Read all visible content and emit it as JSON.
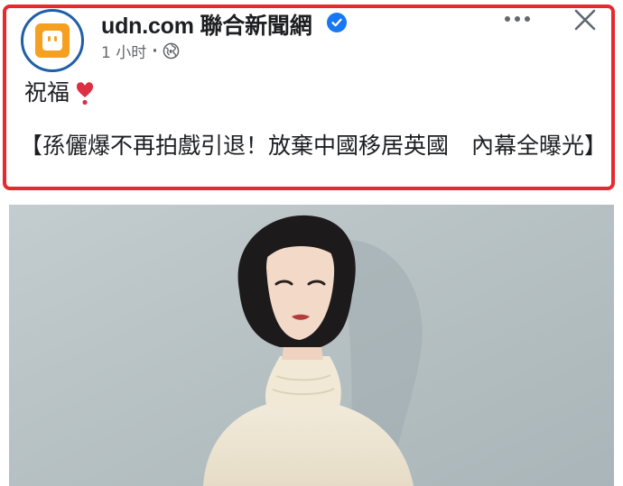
{
  "post": {
    "page_name": "udn.com 聯合新聞網",
    "time": "1 小时",
    "separator": "·",
    "text_line1": "祝福",
    "headline": "【孫儷爆不再拍戲引退！放棄中國移居英國　內幕全曝光】"
  },
  "icons": {
    "verified": "verified-badge-icon",
    "audience": "globe-icon",
    "more": "more-options-icon",
    "close": "close-icon",
    "emoji": "red-heart-exclamation-icon"
  },
  "colors": {
    "highlight_border": "#e8282d",
    "verified_blue": "#1877f2",
    "avatar_ring": "#1f5fa8",
    "avatar_logo": "#f6a021",
    "meta_gray": "#65676b",
    "photo_background": "#b6c1c3"
  }
}
